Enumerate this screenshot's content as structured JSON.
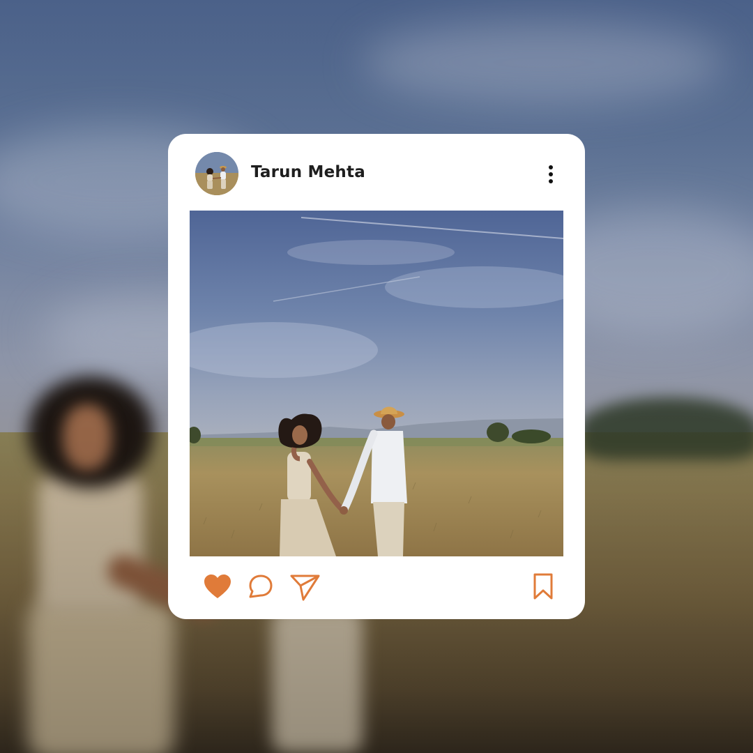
{
  "post": {
    "username": "Tarun Mehta",
    "avatar": "avatar-photo",
    "image": "couple-in-field-photo"
  },
  "actions": {
    "like": {
      "icon": "heart-icon",
      "liked": true
    },
    "comment": {
      "icon": "comment-icon"
    },
    "share": {
      "icon": "send-icon"
    },
    "save": {
      "icon": "bookmark-icon"
    }
  },
  "colors": {
    "accent": "#e07b39",
    "card": "#ffffff",
    "username": "#1e1e1e"
  }
}
